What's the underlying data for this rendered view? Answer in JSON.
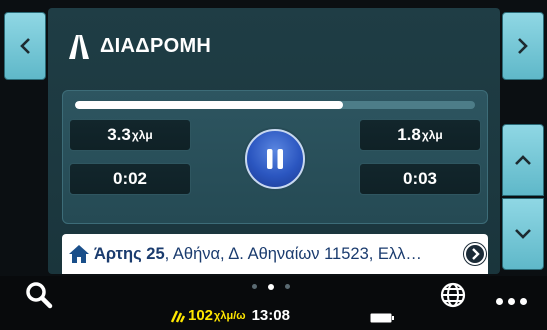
{
  "header": {
    "title": "ΔΙΑΔΡΟΜΗ"
  },
  "progress": {
    "fraction": 0.67
  },
  "stats": {
    "distance_done": {
      "value": "3.3",
      "unit": "χλμ"
    },
    "distance_left": {
      "value": "1.8",
      "unit": "χλμ"
    },
    "time_done": "0:02",
    "time_left": "0:03"
  },
  "destination": {
    "street": "Άρτης 25",
    "rest": ", Αθήνα, Δ. Αθηναίων 11523, Ελλ…"
  },
  "status_bar": {
    "speed_value": "102",
    "speed_unit": "χλμ/ω",
    "time": "13:08"
  },
  "icons": {
    "left_nav": "chevron-left-icon",
    "right_nav": "chevron-right-icon",
    "up_nav": "chevron-up-icon",
    "down_nav": "chevron-down-icon",
    "route": "route-icon",
    "pause": "pause-icon",
    "home": "home-icon",
    "dest_arrow": "arrow-right-circle-icon",
    "search": "search-icon",
    "speed": "speed-icon",
    "battery": "battery-icon",
    "globe": "globe-icon",
    "more": "more-dots-icon"
  },
  "colors": {
    "accent_teal": "#6fc6d6",
    "panel": "#1f3d45",
    "pause_blue": "#2b56c0",
    "speed_yellow": "#ffe700",
    "destination_text": "#1a3b6e"
  }
}
